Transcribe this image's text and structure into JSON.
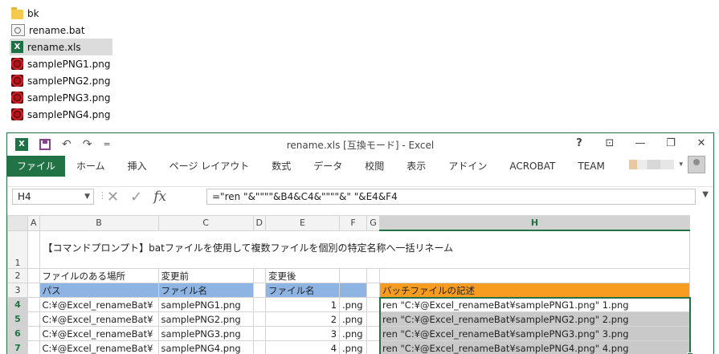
{
  "explorer": {
    "items": [
      {
        "name": "bk",
        "type": "folder",
        "icon": "folder-icon"
      },
      {
        "name": "rename.bat",
        "type": "bat",
        "icon": "batch-file-icon"
      },
      {
        "name": "rename.xls",
        "type": "xls",
        "icon": "excel-file-icon",
        "selected": true
      },
      {
        "name": "samplePNG1.png",
        "type": "png",
        "icon": "png-file-icon"
      },
      {
        "name": "samplePNG2.png",
        "type": "png",
        "icon": "png-file-icon"
      },
      {
        "name": "samplePNG3.png",
        "type": "png",
        "icon": "png-file-icon"
      },
      {
        "name": "samplePNG4.png",
        "type": "png",
        "icon": "png-file-icon"
      }
    ]
  },
  "window": {
    "title": "rename.xls  [互換モード] - Excel",
    "logo_letter": "X",
    "qat": {
      "undo": "↶",
      "redo": "↷",
      "customize": "="
    },
    "controls": {
      "help": "?",
      "ribbon_display": "⊡",
      "minimize": "—",
      "restore": "❐",
      "close": "✕"
    },
    "accent": "#217346"
  },
  "ribbon": {
    "file_tab": "ファイル",
    "tabs": [
      "ホーム",
      "挿入",
      "ページ レイアウト",
      "数式",
      "データ",
      "校閲",
      "表示",
      "アドイン",
      "ACROBAT",
      "TEAM"
    ]
  },
  "formula_bar": {
    "name_box": "H4",
    "cancel": "✕",
    "enter": "✓",
    "fx": "fx",
    "formula": "=\"ren \"&\"\"\"\"&B4&C4&\"\"\"\"&\" \"&E4&F4"
  },
  "sheet": {
    "columns": [
      "A",
      "B",
      "C",
      "D",
      "E",
      "F",
      "G",
      "H"
    ],
    "selected_column": "H",
    "rows": {
      "r1": {
        "num": "1",
        "B": "【コマンドプロンプト】batファイルを使用して複数ファイルを個別の特定名称へ一括リネーム"
      },
      "r2": {
        "num": "2",
        "B": "ファイルのある場所",
        "C": "変更前",
        "E": "変更後"
      },
      "r3": {
        "num": "3",
        "B": "パス",
        "C": "ファイル名",
        "E": "ファイル名",
        "H": "バッチファイルの記述"
      },
      "data": [
        {
          "num": "4",
          "B": "C:¥@Excel_renameBat¥",
          "C": "samplePNG1.png",
          "E": "1",
          "F": ".png",
          "H": "ren \"C:¥@Excel_renameBat¥samplePNG1.png\" 1.png"
        },
        {
          "num": "5",
          "B": "C:¥@Excel_renameBat¥",
          "C": "samplePNG2.png",
          "E": "2",
          "F": ".png",
          "H": "ren \"C:¥@Excel_renameBat¥samplePNG2.png\" 2.png"
        },
        {
          "num": "6",
          "B": "C:¥@Excel_renameBat¥",
          "C": "samplePNG3.png",
          "E": "3",
          "F": ".png",
          "H": "ren \"C:¥@Excel_renameBat¥samplePNG3.png\" 3.png"
        },
        {
          "num": "7",
          "B": "C:¥@Excel_renameBat¥",
          "C": "samplePNG4.png",
          "E": "4",
          "F": ".png",
          "H": "ren \"C:¥@Excel_renameBat¥samplePNG4.png\" 4.png"
        }
      ]
    },
    "colors": {
      "header_blue": "#8db4e2",
      "header_orange": "#f79b21",
      "selection_gray": "#c9c9c9"
    }
  }
}
